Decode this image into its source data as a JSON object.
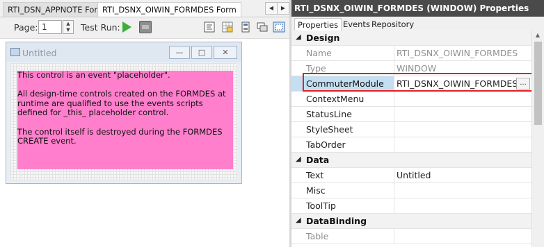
{
  "designer": {
    "tabs": [
      {
        "label": "RTI_DSN_APPNOTE Form"
      },
      {
        "label": "RTI_DSNX_OIWIN_FORMDES Form"
      }
    ],
    "nav": {
      "prev_icon": "chevron-left-icon",
      "next_icon": "chevron-right-icon"
    },
    "toolbar": {
      "page_label": "Page:",
      "page_value": "1",
      "test_run_label": "Test Run:",
      "run_icon": "play-icon",
      "stop_icon": "stop-icon",
      "tools": [
        "align-icon",
        "grid-icon",
        "tab-order-icon",
        "layout-icon",
        "snap-icon"
      ]
    },
    "form": {
      "title": "Untitled",
      "placeholder": {
        "color": "#ff7fcc",
        "paragraph1": "This control is an event \"placeholder\".",
        "paragraph2": "All design-time controls created on the FORMDES at runtime are qualified to use the events scripts defined for _this_ placeholder control.",
        "paragraph3": "The control itself is destroyed during the FORMDES CREATE event."
      }
    }
  },
  "properties": {
    "title": "RTI_DSNX_OIWIN_FORMDES (WINDOW) Properties",
    "tabs": [
      "Properties",
      "Events",
      "Repository"
    ],
    "sections": [
      {
        "name": "Design",
        "rows": [
          {
            "name": "Name",
            "value": "RTI_DSNX_OIWIN_FORMDES",
            "readonly": true
          },
          {
            "name": "Type",
            "value": "WINDOW",
            "readonly": true
          },
          {
            "name": "CommuterModule",
            "value": "RTI_DSNX_OIWIN_FORMDES",
            "selected": true,
            "button": "..."
          },
          {
            "name": "ContextMenu",
            "value": ""
          },
          {
            "name": "StatusLine",
            "value": ""
          },
          {
            "name": "StyleSheet",
            "value": ""
          },
          {
            "name": "TabOrder",
            "value": ""
          }
        ]
      },
      {
        "name": "Data",
        "rows": [
          {
            "name": "Text",
            "value": "Untitled"
          },
          {
            "name": "Misc",
            "value": ""
          },
          {
            "name": "ToolTip",
            "value": ""
          }
        ]
      },
      {
        "name": "DataBinding",
        "rows": [
          {
            "name": "Table",
            "value": "",
            "readonly": true
          }
        ]
      }
    ],
    "highlight_color": "#e02020",
    "selected_color": "#c4dff1"
  }
}
